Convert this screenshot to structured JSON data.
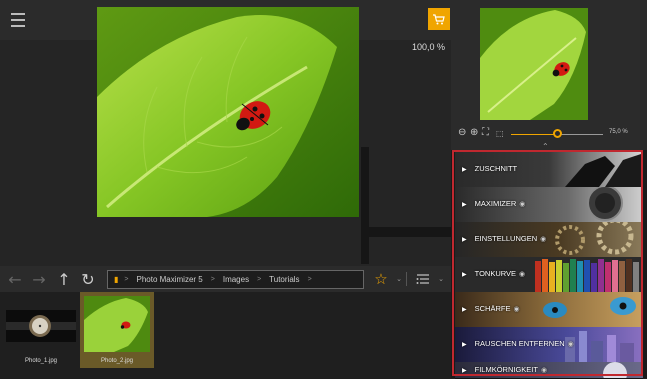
{
  "toolbar": {
    "icons": [
      "menu-icon",
      "undo-icon",
      "redo-back-icon",
      "redo-icon",
      "save-icon",
      "print-icon",
      "single-view-icon",
      "split-view-icon",
      "share-icon",
      "cart-icon"
    ],
    "accent": "#f0a500"
  },
  "main": {
    "zoom_label": "100,0 %"
  },
  "nav": {
    "path": [
      "Photo Maximizer 5",
      "Images",
      "Tutorials"
    ]
  },
  "filmstrip": {
    "items": [
      {
        "label": "Photo_1.jpg",
        "selected": false
      },
      {
        "label": "Photo_2.jpg",
        "selected": true
      }
    ]
  },
  "preview": {
    "zoom_value": "75,0 %",
    "slider_fraction": 0.5
  },
  "panel": {
    "items": [
      {
        "label": "ZUSCHNITT",
        "eye": false
      },
      {
        "label": "MAXIMIZER",
        "eye": true
      },
      {
        "label": "EINSTELLUNGEN",
        "eye": true
      },
      {
        "label": "TONKURVE",
        "eye": true
      },
      {
        "label": "SCHÄRFE",
        "eye": true
      },
      {
        "label": "RAUSCHEN ENTFERNEN",
        "eye": true
      },
      {
        "label": "FILMKÖRNIGKEIT",
        "eye": true
      }
    ],
    "highlight_color": "#c0282f"
  }
}
